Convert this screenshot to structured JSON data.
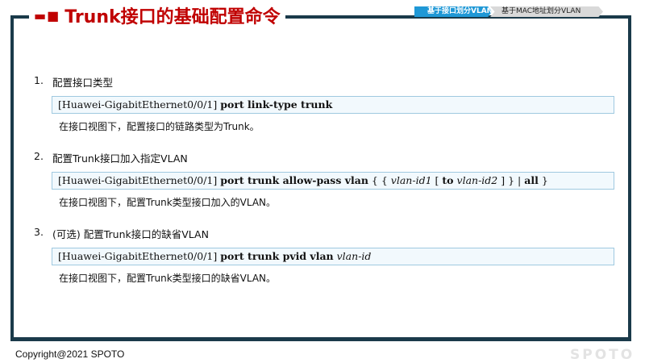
{
  "title": {
    "decoration": "▬■",
    "text": "Trunk接口的基础配置命令"
  },
  "tabs": [
    {
      "label": "基于接口划分VLAN",
      "active": true
    },
    {
      "label": "基于MAC地址划分VLAN",
      "active": false
    }
  ],
  "items": [
    {
      "number": "1.",
      "heading": "配置接口类型",
      "command": {
        "prompt": "[Huawei-GigabitEthernet0/0/1]",
        "keyword": "port link-type trunk"
      },
      "description": "在接口视图下，配置接口的链路类型为Trunk。"
    },
    {
      "number": "2.",
      "heading": "配置Trunk接口加入指定VLAN",
      "command": {
        "prompt": "[Huawei-GigabitEthernet0/0/1]",
        "keyword": "port trunk allow-pass vlan",
        "p1": "{ {",
        "arg1": "vlan-id1",
        "p2": "[",
        "kw_to": "to",
        "arg2": "vlan-id2",
        "p3": "] } |",
        "kw_all": "all",
        "p4": "}"
      },
      "description": "在接口视图下，配置Trunk类型接口加入的VLAN。"
    },
    {
      "number": "3.",
      "heading": "(可选) 配置Trunk接口的缺省VLAN",
      "command": {
        "prompt": "[Huawei-GigabitEthernet0/0/1]",
        "keyword": "port trunk pvid vlan",
        "arg1": "vlan-id"
      },
      "description": "在接口视图下，配置Trunk类型接口的缺省VLAN。"
    }
  ],
  "footer": {
    "copyright": "Copyright@2021 SPOTO",
    "logo": "SPOTO"
  },
  "colors": {
    "title": "#c00000",
    "frame": "#1a3a4a",
    "active_tab": "#1f98d6",
    "command_border": "#9fc9e0"
  }
}
